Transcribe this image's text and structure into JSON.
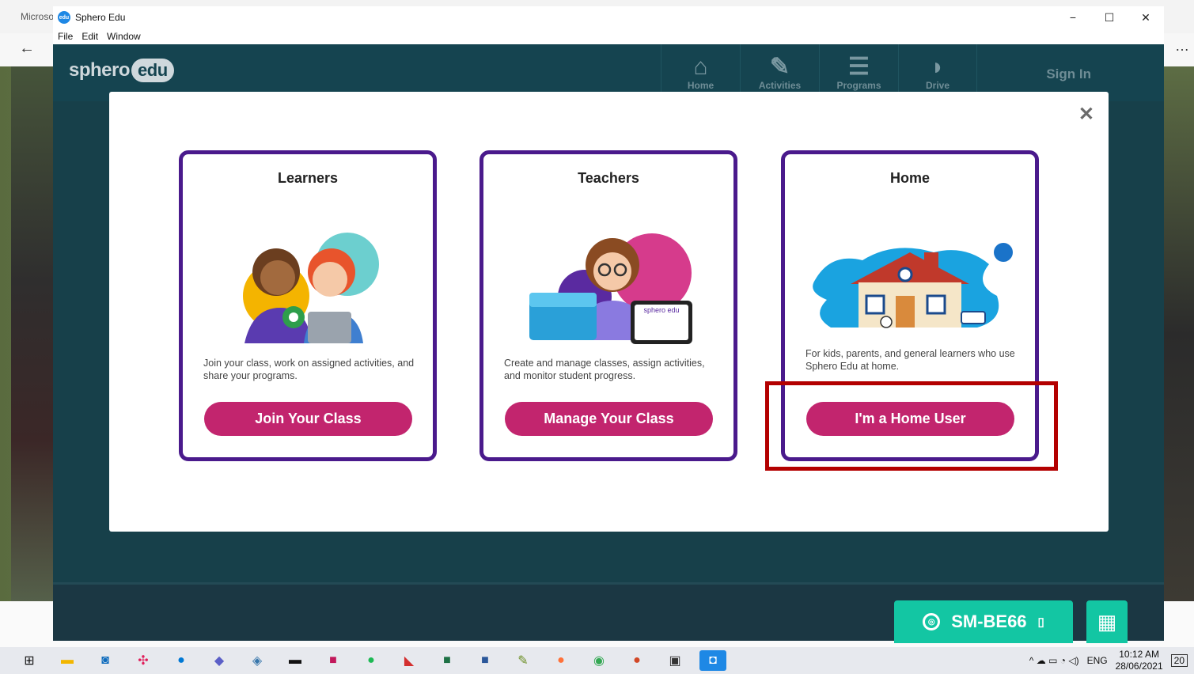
{
  "background": {
    "behind_title": "Microso",
    "back_arrow": "←",
    "more": "…"
  },
  "window": {
    "title": "Sphero Edu",
    "controls": {
      "minimize": "−",
      "maximize": "☐",
      "close": "✕"
    },
    "menu": [
      "File",
      "Edit",
      "Window"
    ]
  },
  "header": {
    "logo_text": "sphero",
    "logo_badge": "edu",
    "nav": [
      {
        "label": "Home",
        "icon": "house-icon",
        "glyph": "⌂"
      },
      {
        "label": "Activities",
        "icon": "pencil-ruler-icon",
        "glyph": "✎"
      },
      {
        "label": "Programs",
        "icon": "stack-icon",
        "glyph": "☰"
      },
      {
        "label": "Drive",
        "icon": "drive-icon",
        "glyph": "◗"
      }
    ],
    "sign_in": "Sign In"
  },
  "modal": {
    "close": "✕",
    "cards": [
      {
        "title": "Learners",
        "description": "Join your class, work on assigned activities, and share your programs.",
        "button": "Join Your Class"
      },
      {
        "title": "Teachers",
        "description": "Create and manage classes, assign activities, and monitor student progress.",
        "button": "Manage Your Class",
        "tablet_text": "sphero edu"
      },
      {
        "title": "Home",
        "description": "For kids, parents, and general learners who use Sphero Edu at home.",
        "button": "I'm a Home User"
      }
    ]
  },
  "footer": {
    "robot_name": "SM-BE66",
    "robot_glyph": "◎",
    "battery_glyph": "▯",
    "qr_glyph": "▦"
  },
  "taskbar": {
    "language": "ENG",
    "time": "10:12 AM",
    "date": "28/06/2021",
    "notifications": "20",
    "tray_glyphs": "^ ☁ ▭ ◔ ◁)"
  },
  "colors": {
    "accent": "#c2256e",
    "card_border": "#4a1a8c",
    "robot": "#13c6a3",
    "highlight": "#b30000"
  }
}
